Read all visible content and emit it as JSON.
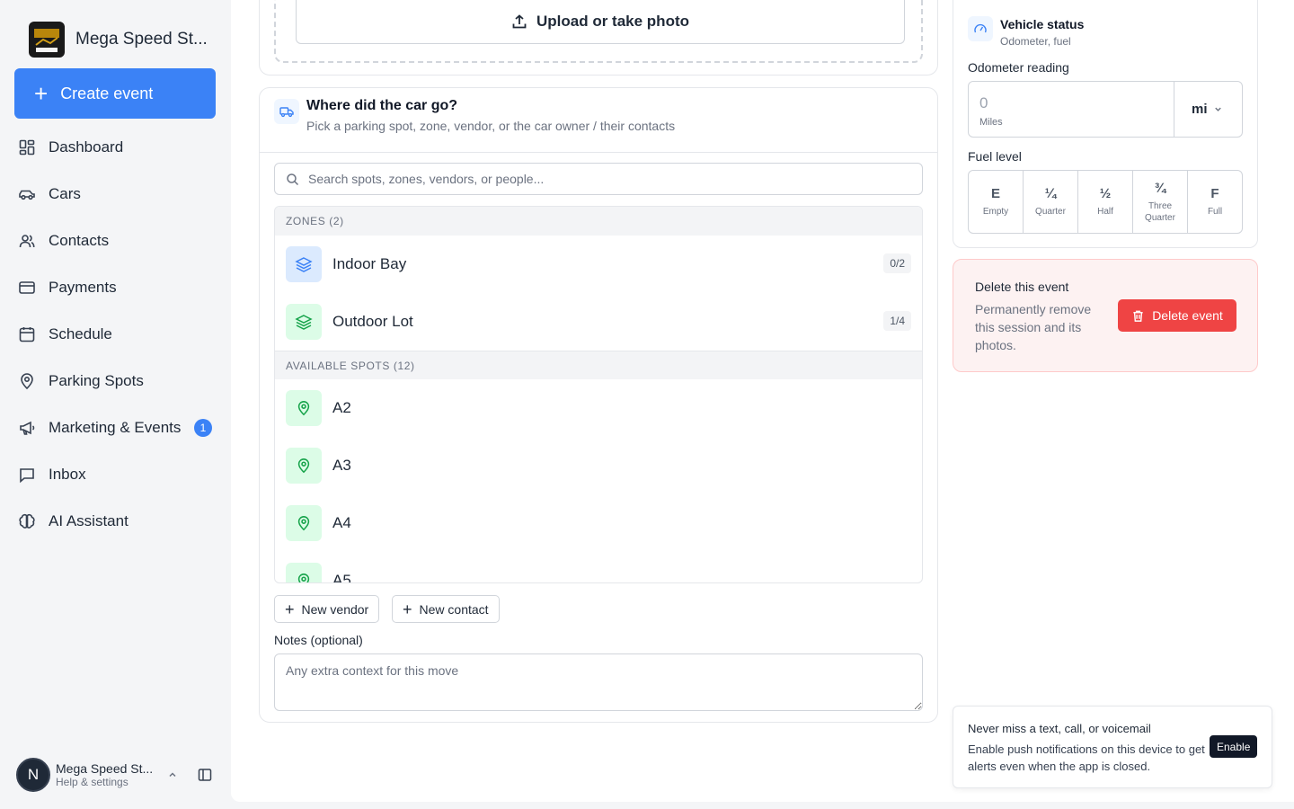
{
  "brand": {
    "name": "Mega Speed St..."
  },
  "sidebar": {
    "create_label": "Create event",
    "items": [
      {
        "label": "Dashboard"
      },
      {
        "label": "Cars"
      },
      {
        "label": "Contacts"
      },
      {
        "label": "Payments"
      },
      {
        "label": "Schedule"
      },
      {
        "label": "Parking Spots"
      },
      {
        "label": "Marketing & Events",
        "badge": "1"
      },
      {
        "label": "Inbox"
      },
      {
        "label": "AI Assistant"
      }
    ],
    "user": {
      "initial": "N",
      "name": "Mega Speed St...",
      "subtitle": "Help & settings"
    }
  },
  "upload": {
    "label": "Upload or take photo"
  },
  "destination": {
    "title": "Where did the car go?",
    "subtitle": "Pick a parking spot, zone, vendor, or the car owner / their contacts",
    "search_placeholder": "Search spots, zones, vendors, or people...",
    "zones_header": "ZONES (2)",
    "zones": [
      {
        "name": "Indoor Bay",
        "count": "0/2"
      },
      {
        "name": "Outdoor Lot",
        "count": "1/4"
      }
    ],
    "spots_header": "AVAILABLE SPOTS (12)",
    "spots": [
      {
        "name": "A2"
      },
      {
        "name": "A3"
      },
      {
        "name": "A4"
      },
      {
        "name": "A5"
      }
    ],
    "new_vendor": "New vendor",
    "new_contact": "New contact",
    "notes_label": "Notes (optional)",
    "notes_placeholder": "Any extra context for this move"
  },
  "vehicle": {
    "title": "Vehicle status",
    "subtitle": "Odometer, fuel",
    "odometer_label": "Odometer reading",
    "odometer_value": "0",
    "odometer_unit_label": "Miles",
    "unit": "mi",
    "fuel_label": "Fuel level",
    "fuel_options": [
      {
        "symbol": "E",
        "label": "Empty"
      },
      {
        "symbol": "¼",
        "label": "Quarter"
      },
      {
        "symbol": "½",
        "label": "Half"
      },
      {
        "symbol": "¾",
        "label": "Three Quarter"
      },
      {
        "symbol": "F",
        "label": "Full"
      }
    ]
  },
  "delete": {
    "title": "Delete this event",
    "description": "Permanently remove this session and its photos.",
    "button": "Delete event"
  },
  "notification": {
    "title": "Never miss a text, call, or voicemail",
    "body": "Enable push notifications on this device to get alerts even when the app is closed.",
    "button": "Enable"
  },
  "colors": {
    "accent": "#3b82f6",
    "danger": "#ef4444",
    "zone_blue": "#dbeafe",
    "spot_green": "#dcfce7"
  }
}
